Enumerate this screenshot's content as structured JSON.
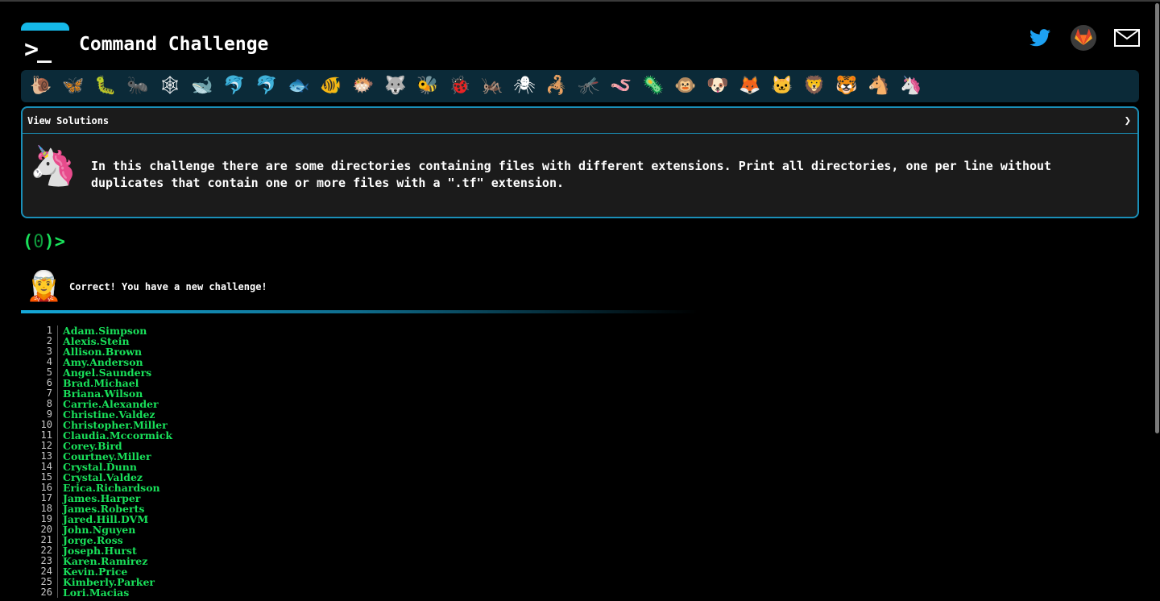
{
  "header": {
    "logo_symbol": ">_",
    "title": "Command Challenge",
    "social": [
      {
        "icon": "twitter-icon",
        "color": "#1da1f2"
      },
      {
        "icon": "gitlab-icon",
        "color": "#fc6d26"
      },
      {
        "icon": "mail-icon",
        "color": "#ffffff"
      }
    ]
  },
  "animals": [
    "🐌",
    "🦋",
    "🐛",
    "🐜",
    "🕸",
    "🐋",
    "🐬",
    "🐬",
    "🐟",
    "🐠",
    "🐡",
    "🐺",
    "🐝",
    "🐞",
    "🦗",
    "🕷",
    "🦂",
    "🦟",
    "🪱",
    "🦠",
    "🐵",
    "🐶",
    "🦊",
    "🐱",
    "🦁",
    "🐯",
    "🐴",
    "🦄"
  ],
  "challenge": {
    "header_label": "View Solutions",
    "description": "In this challenge there are some directories containing files with different extensions. Print all directories, one per line without duplicates that contain one or more files with a \".tf\" extension."
  },
  "prompt": {
    "open": "(",
    "count": "0",
    "close": ")>"
  },
  "result": {
    "message": "Correct! You have a new challenge!"
  },
  "output_lines": [
    {
      "n": "1",
      "v": "Adam.Simpson"
    },
    {
      "n": "2",
      "v": "Alexis.Stein"
    },
    {
      "n": "3",
      "v": "Allison.Brown"
    },
    {
      "n": "4",
      "v": "Amy.Anderson"
    },
    {
      "n": "5",
      "v": "Angel.Saunders"
    },
    {
      "n": "6",
      "v": "Brad.Michael"
    },
    {
      "n": "7",
      "v": "Briana.Wilson"
    },
    {
      "n": "8",
      "v": "Carrie.Alexander"
    },
    {
      "n": "9",
      "v": "Christine.Valdez"
    },
    {
      "n": "10",
      "v": "Christopher.Miller"
    },
    {
      "n": "11",
      "v": "Claudia.Mccormick"
    },
    {
      "n": "12",
      "v": "Corey.Bird"
    },
    {
      "n": "13",
      "v": "Courtney.Miller"
    },
    {
      "n": "14",
      "v": "Crystal.Dunn"
    },
    {
      "n": "15",
      "v": "Crystal.Valdez"
    },
    {
      "n": "16",
      "v": "Erica.Richardson"
    },
    {
      "n": "17",
      "v": "James.Harper"
    },
    {
      "n": "18",
      "v": "James.Roberts"
    },
    {
      "n": "19",
      "v": "Jared.Hill.DVM"
    },
    {
      "n": "20",
      "v": "John.Nguyen"
    },
    {
      "n": "21",
      "v": "Jorge.Ross"
    },
    {
      "n": "22",
      "v": "Joseph.Hurst"
    },
    {
      "n": "23",
      "v": "Karen.Ramirez"
    },
    {
      "n": "24",
      "v": "Kevin.Price"
    },
    {
      "n": "25",
      "v": "Kimberly.Parker"
    },
    {
      "n": "26",
      "v": "Lori.Macias"
    }
  ]
}
